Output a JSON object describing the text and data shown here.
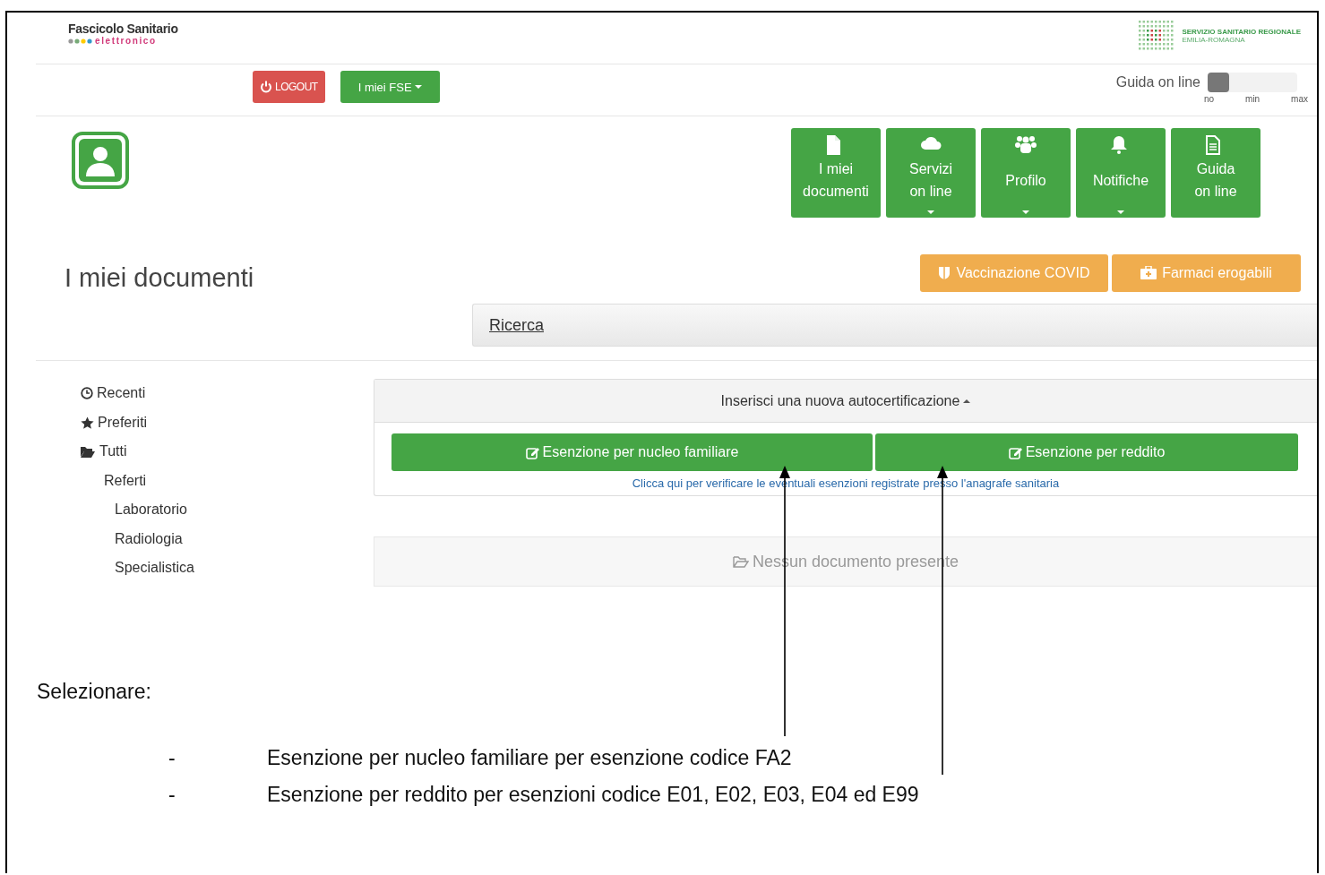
{
  "logo": {
    "line1": "Fascicolo Sanitario",
    "line2": "elettronico"
  },
  "region_logo": {
    "line1": "SERVIZIO SANITARIO REGIONALE",
    "line2": "EMILIA-ROMAGNA"
  },
  "toolbar": {
    "buttons": [
      {
        "label": "LOGOUT",
        "kind": "logout"
      },
      {
        "label": "I miei FSE",
        "kind": "dropdown"
      }
    ]
  },
  "guide_slider": {
    "label": "Guida on line",
    "level": 0,
    "ticks": [
      "no",
      "min",
      "max"
    ]
  },
  "nav_tiles": [
    {
      "lines": [
        "I miei",
        "documenti"
      ],
      "dropdown": false
    },
    {
      "lines": [
        "Servizi",
        "on line"
      ],
      "dropdown": true
    },
    {
      "lines": [
        "Profilo"
      ],
      "dropdown": true
    },
    {
      "lines": [
        "Notifiche"
      ],
      "dropdown": true
    },
    {
      "lines": [
        "Guida",
        "on line"
      ],
      "dropdown": false
    }
  ],
  "page_title": "I miei documenti",
  "quick_buttons": [
    {
      "label": "Vaccinazione COVID"
    },
    {
      "label": "Farmaci erogabili"
    }
  ],
  "search_bar": {
    "label": "Ricerca"
  },
  "sidebar": {
    "items": [
      {
        "label": "Recenti"
      },
      {
        "label": "Preferiti"
      },
      {
        "label": "Tutti",
        "children": [
          {
            "label": "Referti",
            "children": [
              {
                "label": "Laboratorio"
              },
              {
                "label": "Radiologia"
              },
              {
                "label": "Specialistica"
              }
            ]
          }
        ]
      }
    ]
  },
  "self_certification": {
    "header": "Inserisci una nuova autocertificazione",
    "expanded": true,
    "buttons": [
      {
        "label": "Esenzione per nucleo familiare"
      },
      {
        "label": "Esenzione per reddito"
      }
    ],
    "link": "Clicca qui per verificare le eventuali esenzioni registrate presso l'anagrafe sanitaria"
  },
  "documents": {
    "empty_message": "Nessun documento presente"
  },
  "instructions": {
    "intro": "Selezionare:",
    "items": [
      {
        "bullet": "-",
        "text": "Esenzione per nucleo familiare per esenzione codice FA2"
      },
      {
        "bullet": "-",
        "text": "Esenzione per reddito per esenzioni codice E01, E02, E03, E04 ed E99"
      }
    ]
  }
}
